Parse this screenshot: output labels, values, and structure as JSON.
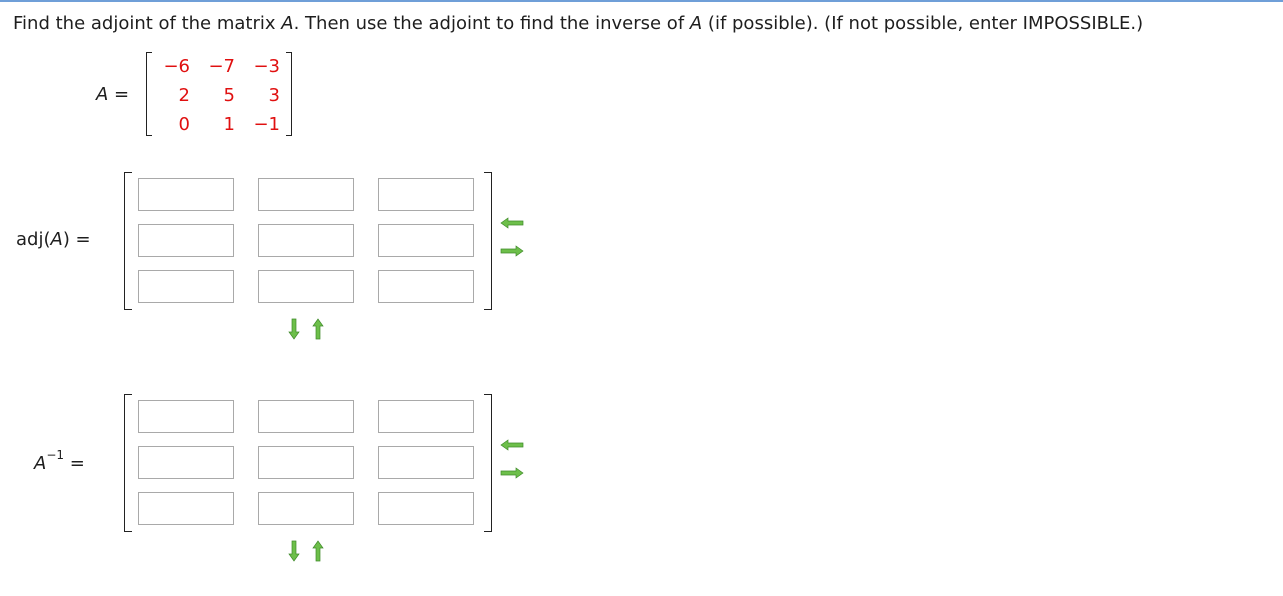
{
  "question": {
    "part1": "Find the adjoint of the matrix ",
    "var1": "A",
    "part2": ". Then use the adjoint to find the inverse of ",
    "var2": "A",
    "part3": " (if possible). (If not possible, enter IMPOSSIBLE.)"
  },
  "given_matrix": {
    "label_var": "A",
    "label_eq": " =",
    "rows": [
      [
        "−6",
        "−7",
        "−3"
      ],
      [
        "2",
        "5",
        "3"
      ],
      [
        "0",
        "1",
        "−1"
      ]
    ]
  },
  "adjoint": {
    "label_prefix": "adj(",
    "label_var": "A",
    "label_suffix": ") =",
    "cells": [
      [
        "",
        "",
        ""
      ],
      [
        "",
        "",
        ""
      ],
      [
        "",
        "",
        ""
      ]
    ]
  },
  "inverse": {
    "label_var": "A",
    "label_sup": "−1",
    "label_eq": " =",
    "cells": [
      [
        "",
        "",
        ""
      ],
      [
        "",
        "",
        ""
      ],
      [
        "",
        "",
        ""
      ]
    ]
  },
  "icons": {
    "remove_column": "arrow-left-icon",
    "add_column": "arrow-right-icon",
    "add_row": "arrow-down-icon",
    "remove_row": "arrow-up-icon",
    "arrow_color": "#6dbf4a",
    "value_color": "#e01010"
  }
}
